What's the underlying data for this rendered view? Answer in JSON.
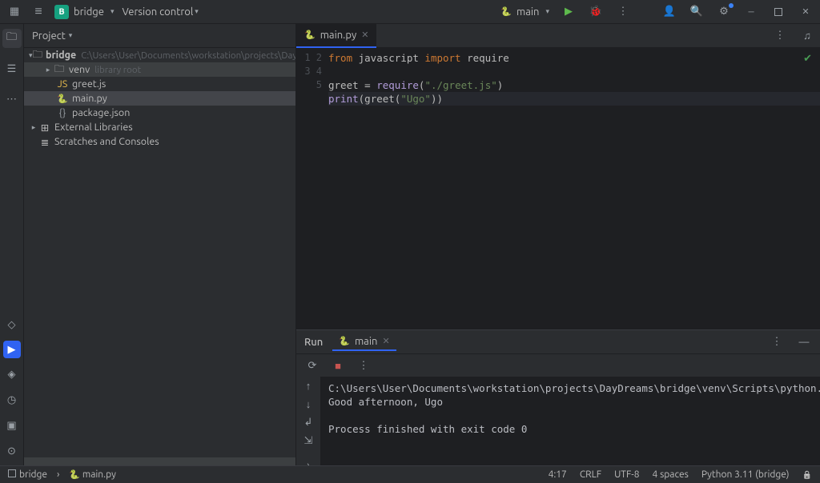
{
  "titlebar": {
    "project_badge": "B",
    "project_name": "bridge",
    "vc_label": "Version control",
    "run_config": "main"
  },
  "project_panel": {
    "title": "Project",
    "root": {
      "name": "bridge",
      "path": "C:\\Users\\User\\Documents\\workstation\\projects\\DayDrea"
    },
    "venv": {
      "name": "venv",
      "hint": "library root"
    },
    "files": [
      "greet.js",
      "main.py",
      "package.json"
    ],
    "external": "External Libraries",
    "scratches": "Scratches and Consoles"
  },
  "editor": {
    "tab_filename": "main.py",
    "lines": [
      {
        "n": 1,
        "seg": [
          [
            "kw",
            "from"
          ],
          [
            "",
            " javascript "
          ],
          [
            "kw",
            "import"
          ],
          [
            "",
            " require"
          ]
        ]
      },
      {
        "n": 2,
        "seg": []
      },
      {
        "n": 3,
        "seg": [
          [
            "",
            "greet = "
          ],
          [
            "fn",
            "require"
          ],
          [
            "",
            "("
          ],
          [
            "str",
            "\"./greet.js\""
          ],
          [
            "",
            ")"
          ]
        ]
      },
      {
        "n": 4,
        "seg": [
          [
            "fn",
            "print"
          ],
          [
            "",
            "(greet("
          ],
          [
            "str",
            "\"Ugo\""
          ],
          [
            "",
            "))"
          ]
        ],
        "caret": true
      },
      {
        "n": 5,
        "seg": []
      }
    ]
  },
  "run": {
    "panel_label": "Run",
    "config_name": "main",
    "console_lines": [
      "C:\\Users\\User\\Documents\\workstation\\projects\\DayDreams\\bridge\\venv\\Scripts\\python.exe C:\\Users\\User\\Documents\\workstation\\projects\\DayDreams\\bridge\\main.py",
      "Good afternoon, Ugo",
      "",
      "Process finished with exit code 0"
    ]
  },
  "status": {
    "breadcrumb_project": "bridge",
    "breadcrumb_file": "main.py",
    "caret": "4:17",
    "eol": "CRLF",
    "encoding": "UTF-8",
    "indent": "4 spaces",
    "interpreter": "Python 3.11 (bridge)"
  }
}
